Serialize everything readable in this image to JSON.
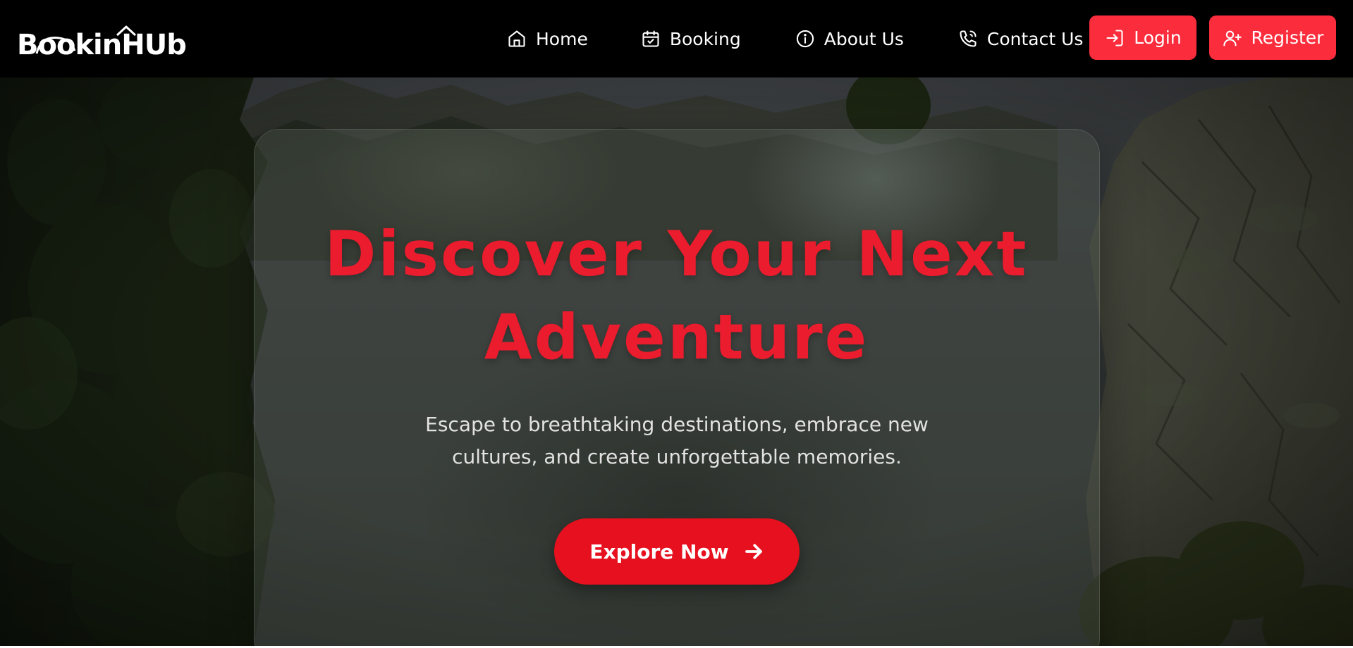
{
  "brand": {
    "logo_text": "BookinHUb",
    "logo_icon": "house-roof-icon"
  },
  "nav": {
    "items": [
      {
        "label": "Home",
        "icon": "home-icon"
      },
      {
        "label": "Booking",
        "icon": "calendar-check-icon"
      },
      {
        "label": "About Us",
        "icon": "info-icon"
      },
      {
        "label": "Contact Us",
        "icon": "phone-icon"
      }
    ],
    "login_label": "Login",
    "login_icon": "login-icon",
    "register_label": "Register",
    "register_icon": "user-plus-icon"
  },
  "hero": {
    "title_line1": "Discover Your Next",
    "title_line2": "Adventure",
    "subtitle_line1": "Escape to breathtaking destinations, embrace new",
    "subtitle_line2": "cultures, and create unforgettable memories.",
    "cta_label": "Explore Now",
    "cta_icon": "arrow-right-icon"
  },
  "colors": {
    "accent": "#fb2c3c",
    "title": "#ea1c2d",
    "cta": "#e6101e",
    "navbar_bg": "#000000"
  }
}
